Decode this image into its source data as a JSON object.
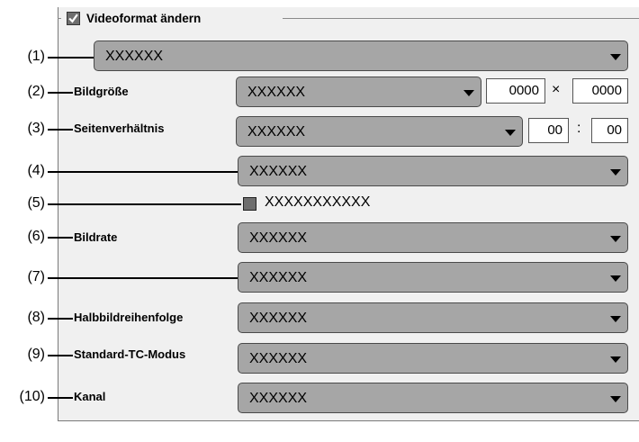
{
  "group": {
    "title": "Videoformat ändern",
    "checked": true
  },
  "rows": {
    "r1": {
      "number": "(1)",
      "value": "XXXXXX"
    },
    "r2": {
      "number": "(2)",
      "label": "Bildgröße",
      "value": "XXXXXX",
      "width": "0000",
      "separator": "×",
      "height": "0000"
    },
    "r3": {
      "number": "(3)",
      "label": "Seitenverhältnis",
      "value": "XXXXXX",
      "ratio_a": "00",
      "separator": ":",
      "ratio_b": "00"
    },
    "r4": {
      "number": "(4)",
      "value": "XXXXXX"
    },
    "r5": {
      "number": "(5)",
      "checkbox_label": "XXXXXXXXXXX",
      "checked": false
    },
    "r6": {
      "number": "(6)",
      "label": "Bildrate",
      "value": "XXXXXX"
    },
    "r7": {
      "number": "(7)",
      "value": "XXXXXX"
    },
    "r8": {
      "number": "(8)",
      "label": "Halbbildreihenfolge",
      "value": "XXXXXX"
    },
    "r9": {
      "number": "(9)",
      "label": "Standard-TC-Modus",
      "value": "XXXXXX"
    },
    "r10": {
      "number": "(10)",
      "label": "Kanal",
      "value": "XXXXXX"
    }
  },
  "icons": {
    "dropdown": "chevron-down-icon",
    "check": "check-icon"
  },
  "colors": {
    "panel": "#f0f0f0",
    "combo": "#a6a6a6",
    "checkbox": "#6e6e6e"
  }
}
